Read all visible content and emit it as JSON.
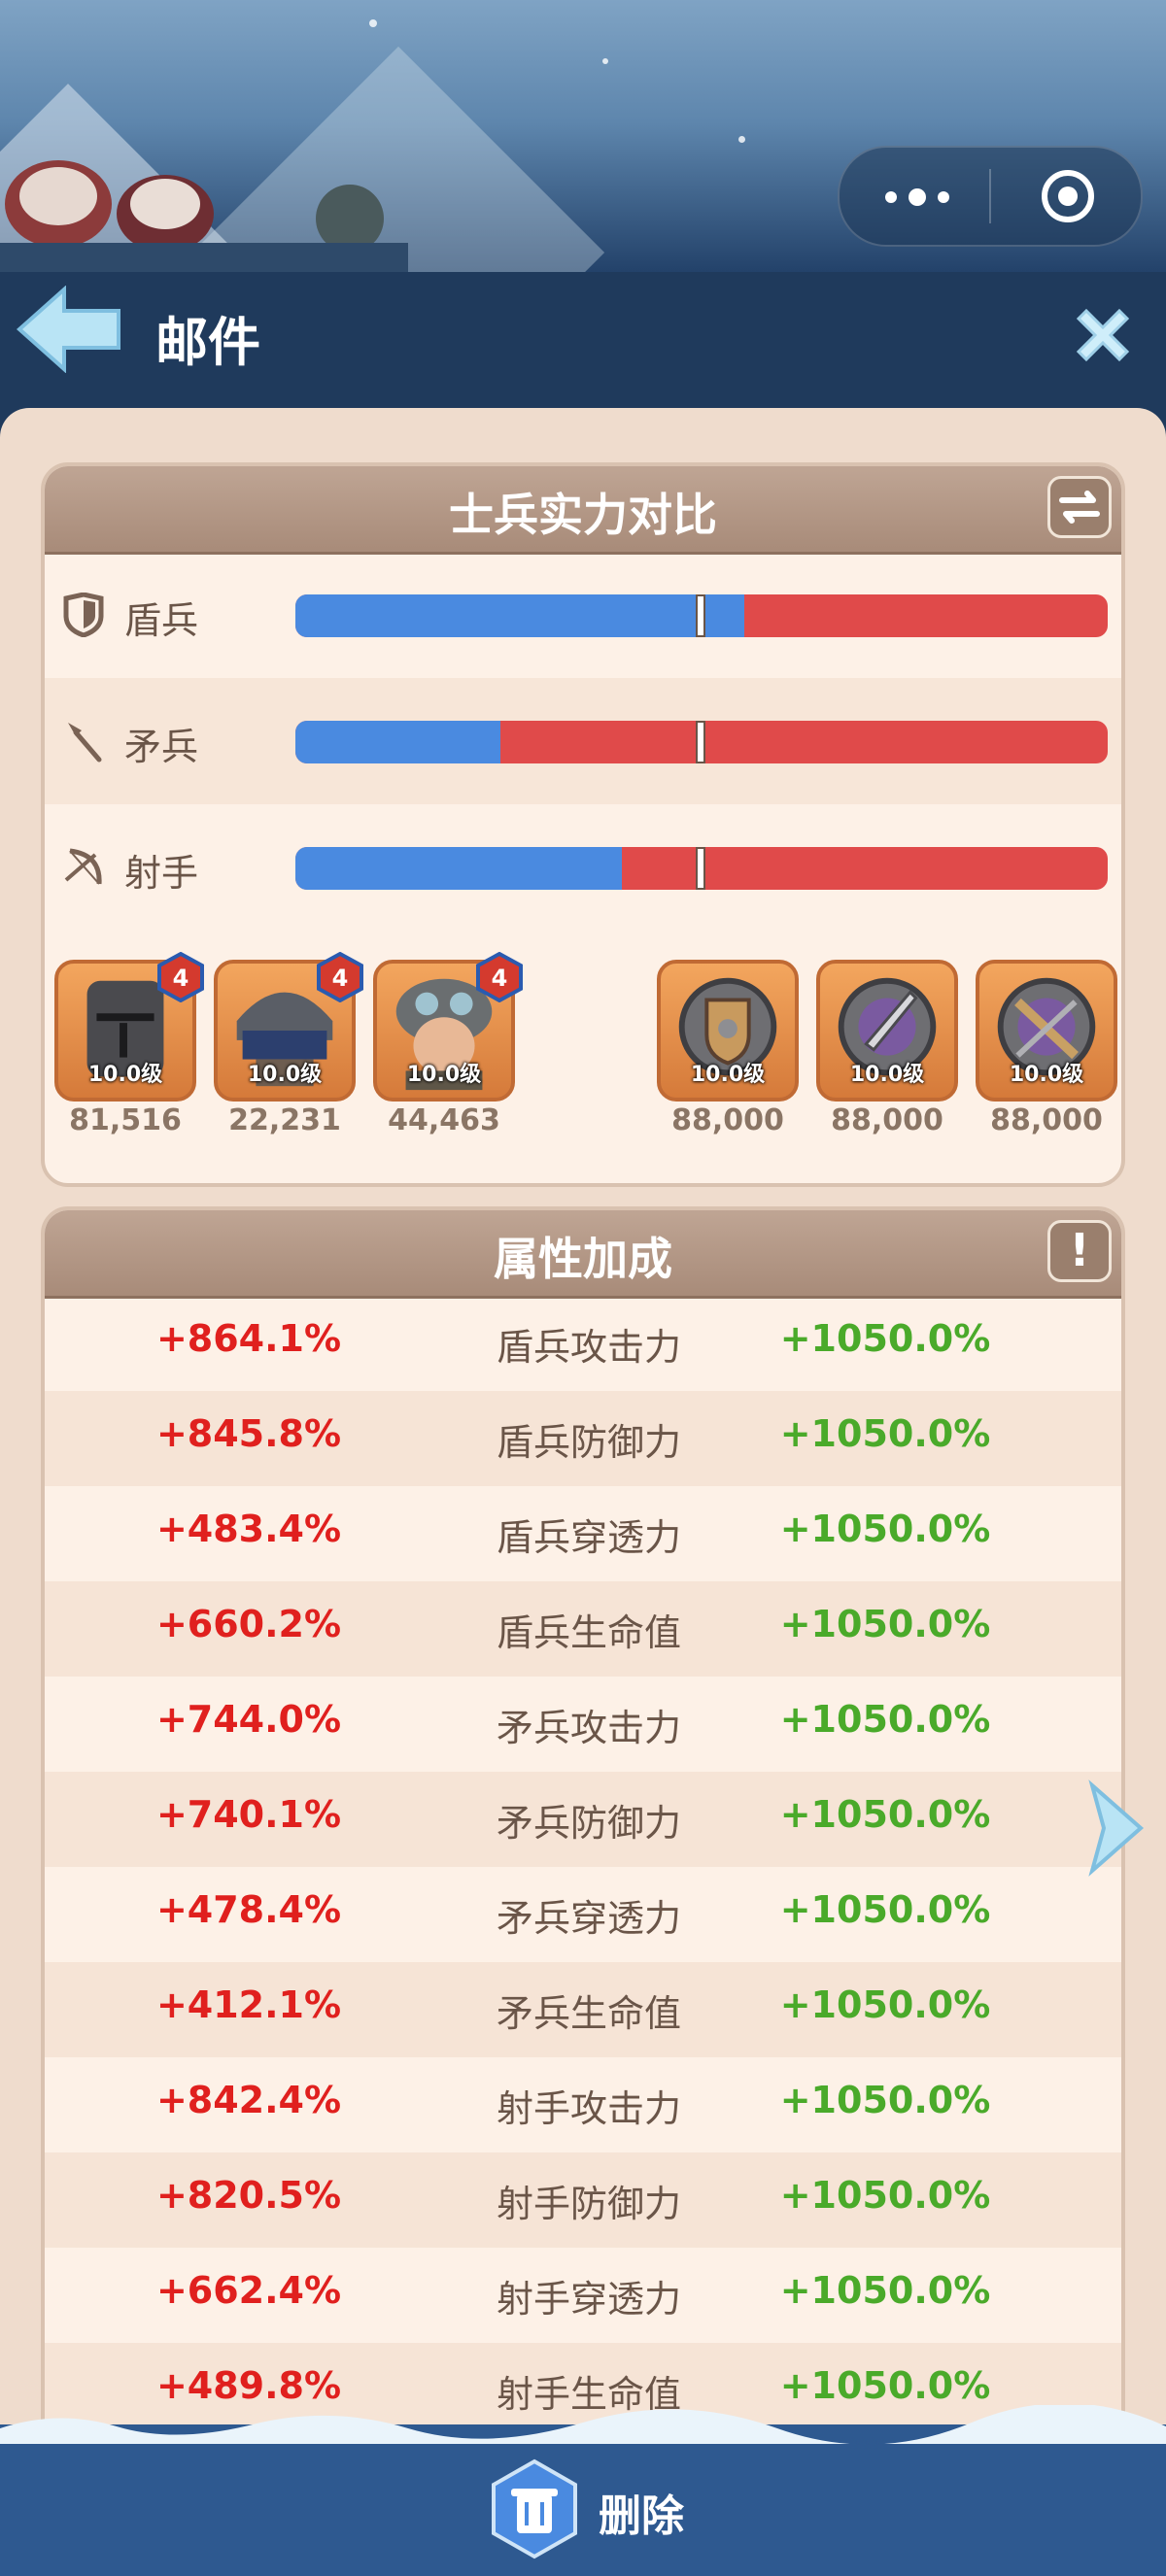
{
  "header": {
    "title": "邮件"
  },
  "compare": {
    "title": "士兵实力对比",
    "rows": [
      {
        "label": "盾兵",
        "icon": "shield-icon",
        "ratio": 0.553
      },
      {
        "label": "矛兵",
        "icon": "spear-icon",
        "ratio": 0.252
      },
      {
        "label": "射手",
        "icon": "bow-icon",
        "ratio": 0.402
      }
    ],
    "left_units": [
      {
        "level": "10.0级",
        "value": "81,516",
        "star": "4",
        "portrait": "knight-helmet-portrait"
      },
      {
        "level": "10.0级",
        "value": "22,231",
        "star": "4",
        "portrait": "spearman-portrait"
      },
      {
        "level": "10.0级",
        "value": "44,463",
        "star": "4",
        "portrait": "goggles-soldier-portrait"
      }
    ],
    "right_units": [
      {
        "level": "10.0级",
        "value": "88,000",
        "emblem": "shield-emblem"
      },
      {
        "level": "10.0级",
        "value": "88,000",
        "emblem": "sword-emblem"
      },
      {
        "level": "10.0级",
        "value": "88,000",
        "emblem": "crossbow-emblem"
      }
    ]
  },
  "attributes": {
    "title": "属性加成",
    "rows": [
      {
        "left": "+864.1%",
        "name": "盾兵攻击力",
        "right": "+1050.0%"
      },
      {
        "left": "+845.8%",
        "name": "盾兵防御力",
        "right": "+1050.0%"
      },
      {
        "left": "+483.4%",
        "name": "盾兵穿透力",
        "right": "+1050.0%"
      },
      {
        "left": "+660.2%",
        "name": "盾兵生命值",
        "right": "+1050.0%"
      },
      {
        "left": "+744.0%",
        "name": "矛兵攻击力",
        "right": "+1050.0%"
      },
      {
        "left": "+740.1%",
        "name": "矛兵防御力",
        "right": "+1050.0%"
      },
      {
        "left": "+478.4%",
        "name": "矛兵穿透力",
        "right": "+1050.0%"
      },
      {
        "left": "+412.1%",
        "name": "矛兵生命值",
        "right": "+1050.0%"
      },
      {
        "left": "+842.4%",
        "name": "射手攻击力",
        "right": "+1050.0%"
      },
      {
        "left": "+820.5%",
        "name": "射手防御力",
        "right": "+1050.0%"
      },
      {
        "left": "+662.4%",
        "name": "射手穿透力",
        "right": "+1050.0%"
      },
      {
        "left": "+489.8%",
        "name": "射手生命值",
        "right": "+1050.0%"
      }
    ]
  },
  "footer": {
    "delete_label": "删除"
  },
  "colors": {
    "header_bg": "#1f3a5c",
    "panel_bg": "#efdccd",
    "bar_blue": "#4a8ae0",
    "bar_red": "#e04a4a",
    "attr_red": "#e0201e",
    "attr_green": "#4aaa2a",
    "bottom_bar": "#2e5990"
  }
}
